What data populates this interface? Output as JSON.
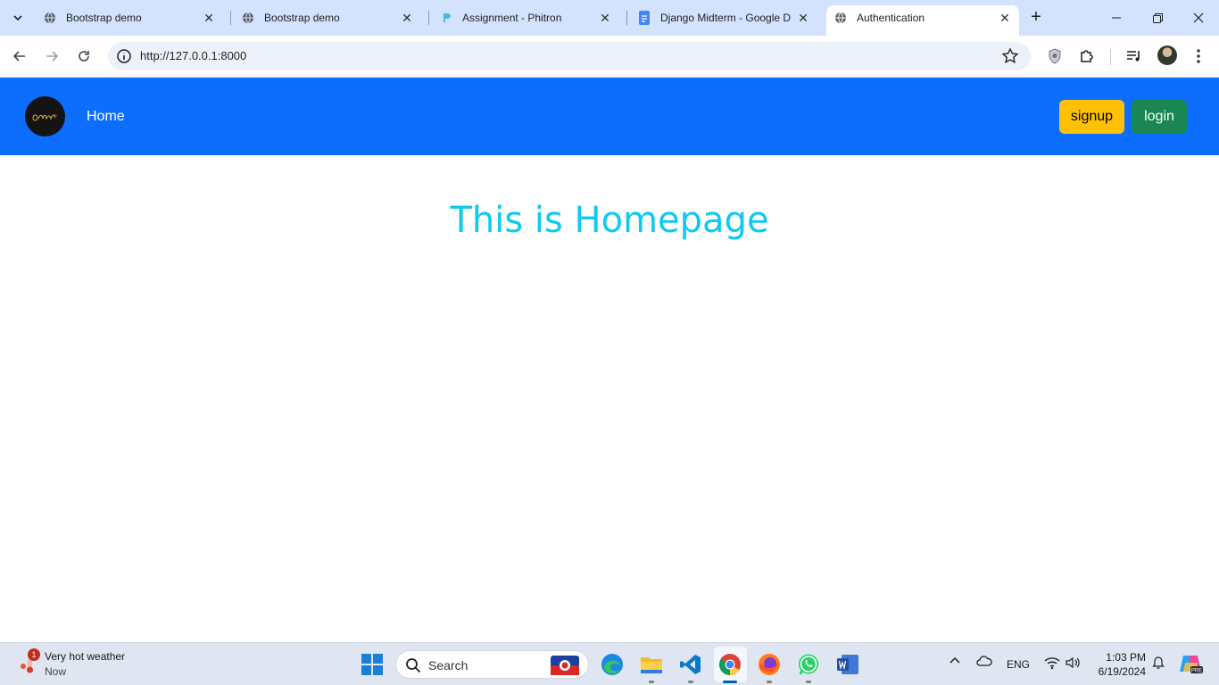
{
  "browser": {
    "tabs": [
      {
        "title": "Bootstrap demo",
        "icon": "globe-icon"
      },
      {
        "title": "Bootstrap demo",
        "icon": "globe-icon"
      },
      {
        "title": "Assignment - Phitron",
        "icon": "phitron-icon"
      },
      {
        "title": "Django Midterm - Google D",
        "icon": "google-docs-icon"
      },
      {
        "title": "Authentication",
        "icon": "globe-icon",
        "active": true
      }
    ],
    "url": "http://127.0.0.1:8000"
  },
  "page": {
    "navbar": {
      "home_label": "Home",
      "signup_label": "signup",
      "login_label": "login",
      "bg_color": "#0d6efd",
      "signup_color": "#ffc107",
      "login_color": "#198754"
    },
    "headline": "This is Homepage",
    "headline_color": "#0dcaf0"
  },
  "taskbar": {
    "weather": {
      "title": "Very hot weather",
      "subtitle": "Now",
      "badge": "1"
    },
    "search_label": "Search",
    "language": "ENG",
    "time": "1:03 PM",
    "date": "6/19/2024"
  }
}
